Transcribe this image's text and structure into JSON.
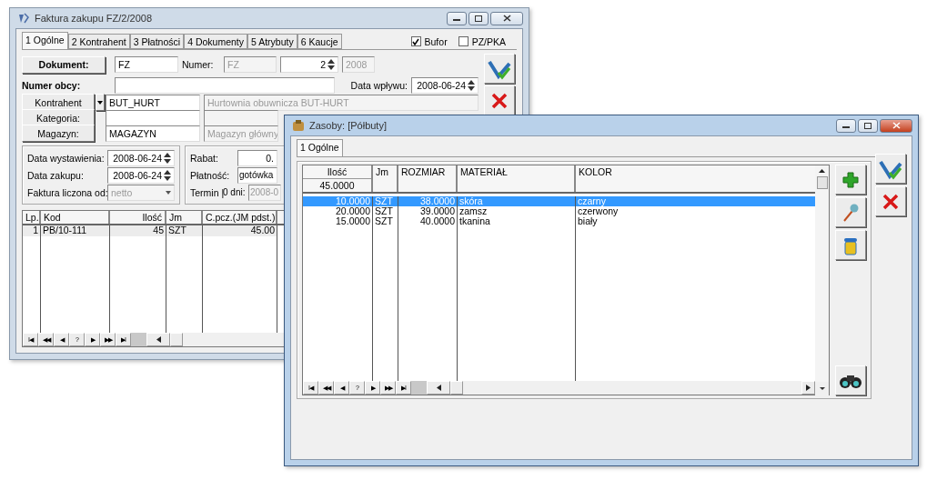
{
  "invoice_window": {
    "title": "Faktura zakupu FZ/2/2008",
    "active": false,
    "tabs": [
      {
        "label": "1 Ogólne",
        "selected": true
      },
      {
        "label": "2 Kontrahent",
        "selected": false
      },
      {
        "label": "3 Płatności",
        "selected": false
      },
      {
        "label": "4 Dokumenty",
        "selected": false
      },
      {
        "label": "5 Atrybuty",
        "selected": false
      },
      {
        "label": "6 Kaucje",
        "selected": false
      }
    ],
    "options": [
      {
        "label": "Bufor",
        "checked": true
      },
      {
        "label": "PZ/PKA",
        "checked": false
      }
    ],
    "document": {
      "button": "Dokument:",
      "type": {
        "value": "FZ",
        "disabled": false
      },
      "number_label": "Numer:",
      "series": {
        "value": "FZ",
        "disabled": true
      },
      "number": {
        "value": "2",
        "disabled": false
      },
      "year": {
        "value": "2008",
        "disabled": true
      }
    },
    "foreign_number": {
      "label": "Numer obcy:"
    },
    "received": {
      "label": "Data wpływu:",
      "value": "2008-06-24"
    },
    "parties": [
      {
        "button": "Kontrahent",
        "dropdown": true,
        "code": "BUT_HURT",
        "name": "Hurtownia obuwnicza BUT-HURT"
      },
      {
        "button": "Kategoria:",
        "dropdown": false
      },
      {
        "button": "Magazyn:",
        "dropdown": false,
        "code": "MAGAZYN",
        "name": "Magazyn główny"
      }
    ],
    "dates": [
      {
        "label": "Data wystawienia:",
        "value": "2008-06-24"
      },
      {
        "label": "Data zakupu:",
        "value": "2008-06-24"
      }
    ],
    "calc_from": {
      "label": "Faktura liczona od:",
      "value": "netto",
      "disabled": true
    },
    "terms": [
      {
        "kind": "number",
        "label": "Rabat:",
        "value": "0."
      },
      {
        "kind": "select",
        "label": "Płatność:",
        "value": "gotówka"
      },
      {
        "kind": "date",
        "label": "Termin |",
        "days": "0 dni:",
        "value": "2008-0",
        "disabled": true
      }
    ],
    "grid": {
      "columns": [
        "Lp.",
        "Kod",
        "Ilość",
        "Jm",
        "C.pcz.(JM pdst.)"
      ],
      "rows": [
        {
          "cells": [
            "1",
            "PB/10-111",
            "45",
            "SZT",
            "45.00"
          ],
          "selected": true
        }
      ]
    },
    "navigator": [
      "I◀",
      "◀◀",
      "◀",
      "?",
      "▶",
      "▶▶",
      "▶I"
    ]
  },
  "stock_window": {
    "title": "Zasoby: [Półbuty]",
    "active": true,
    "tabs": [
      {
        "label": "1 Ogólne",
        "selected": true
      }
    ],
    "grid": {
      "columns": [
        "Ilość",
        "Jm",
        "ROZMIAR",
        "MATERIAŁ",
        "KOLOR"
      ],
      "total": "45.0000",
      "rows": [
        {
          "cells": [
            "10.0000",
            "SZT",
            "38.0000",
            "skóra",
            "czarny"
          ],
          "selected": true
        },
        {
          "cells": [
            "20.0000",
            "SZT",
            "39.0000",
            "zamsz",
            "czerwony"
          ],
          "selected": false
        },
        {
          "cells": [
            "15.0000",
            "SZT",
            "40.0000",
            "tkanina",
            "biały"
          ],
          "selected": false
        }
      ]
    },
    "navigator": [
      "I◀",
      "◀◀",
      "◀",
      "?",
      "▶",
      "▶▶",
      "▶I"
    ]
  }
}
